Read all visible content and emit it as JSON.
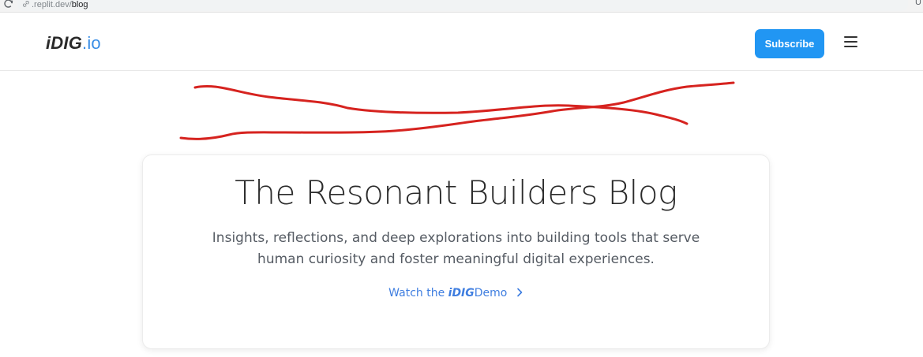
{
  "browser": {
    "url_host": ".replit.dev/",
    "url_path": "blog",
    "right_glyph": "Ů"
  },
  "header": {
    "logo_main": "iDIG",
    "logo_tld": ".io",
    "subscribe_label": "Subscribe",
    "menu_icon": "hamburger-icon"
  },
  "hero": {
    "title": "The Resonant Builders Blog",
    "subtitle": "Insights, reflections, and deep explorations into building tools that serve human curiosity and foster meaningful digital experiences.",
    "cta_prefix": "Watch the ",
    "cta_brand": "iDIG",
    "cta_suffix": "Demo"
  },
  "colors": {
    "accent": "#2196f3",
    "link": "#3f7ee0",
    "annotation": "#d6231f"
  }
}
